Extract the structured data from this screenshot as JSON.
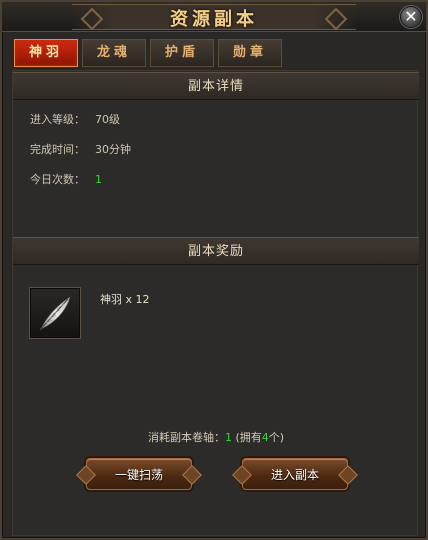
{
  "window": {
    "title": "资源副本",
    "close_glyph": "✕"
  },
  "tabs": [
    {
      "label": "神羽",
      "active": true
    },
    {
      "label": "龙魂",
      "active": false
    },
    {
      "label": "护盾",
      "active": false
    },
    {
      "label": "勋章",
      "active": false
    }
  ],
  "details": {
    "header": "副本详情",
    "level_label": "进入等级：",
    "level_value": "70级",
    "time_label": "完成时间：",
    "time_value": "30分钟",
    "count_label": "今日次数：",
    "count_value": "1"
  },
  "rewards": {
    "header": "副本奖励",
    "item_icon": "feather-icon",
    "item_name": "神羽 x 12"
  },
  "consume": {
    "prefix": "消耗副本卷轴：",
    "amount": "1",
    "own_prefix": "(拥有",
    "own_count": "4",
    "own_suffix": "个)"
  },
  "buttons": {
    "sweep_label": "一键扫荡",
    "enter_label": "进入副本"
  },
  "colors": {
    "accent_green": "#37d437",
    "tab_active": "#c1230e",
    "title_gold": "#f0cf8a"
  }
}
